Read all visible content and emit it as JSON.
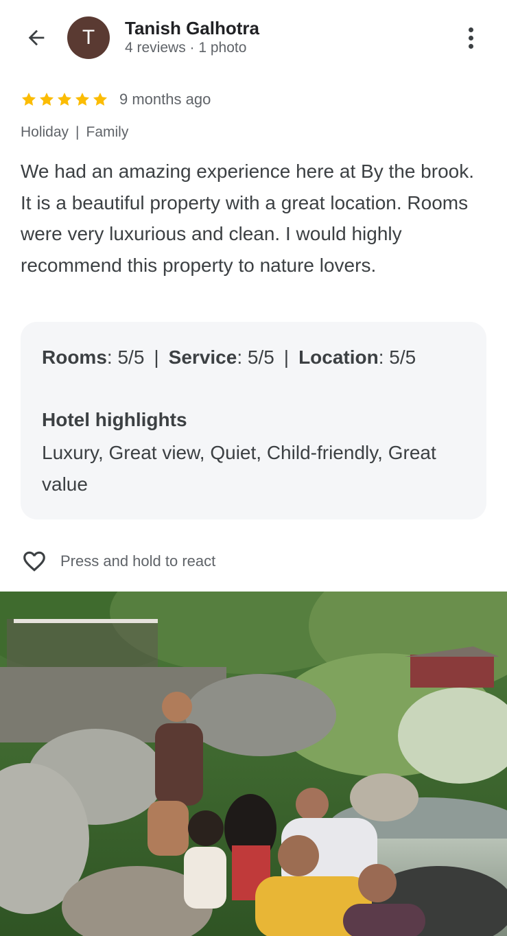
{
  "header": {
    "back_icon": "arrow-left-icon",
    "avatar_letter": "T",
    "reviewer_name": "Tanish Galhotra",
    "reviewer_meta": "4 reviews · 1 photo",
    "more_icon": "more-vertical-icon"
  },
  "review": {
    "rating": 5,
    "rating_max": 5,
    "time_ago": "9 months ago",
    "tags": [
      "Holiday",
      "Family"
    ],
    "text": "We had an amazing experience here at By the brook. It is a beautiful property with a great location. Rooms were very luxurious and clean. I would highly recommend this property to nature lovers."
  },
  "scores": {
    "rooms_label": "Rooms",
    "rooms_value": ": 5/5",
    "service_label": "Service",
    "service_value": ": 5/5",
    "location_label": "Location",
    "location_value": ": 5/5",
    "separator": "|"
  },
  "highlights": {
    "title": "Hotel highlights",
    "text": "Luxury, Great view, Quiet, Child-friendly, Great value"
  },
  "react": {
    "icon": "heart-outline-icon",
    "label": "Press and hold to react"
  },
  "colors": {
    "star": "#fbbc04",
    "avatar_bg": "#5a3a32",
    "card_bg": "#f5f6f8"
  }
}
